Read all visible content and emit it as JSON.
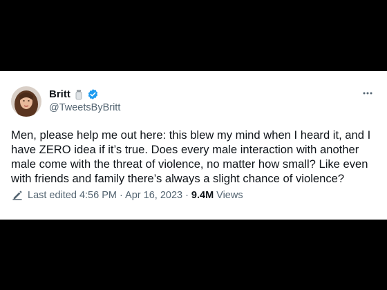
{
  "tweet": {
    "author_name": "Britt",
    "handle": "@TweetsByBritt",
    "text": "Men, please help me out here: this blew my mind when I heard it, and I have ZERO idea if it’s true. Does every male interaction with another male come with the threat of violence, no matter how small? Like even with friends and family there’s always a slight chance of violence?",
    "last_edited_label": "Last edited",
    "timestamp": "4:56 PM · Apr 16, 2023",
    "separator": "·",
    "views_count": "9.4M",
    "views_label": "Views"
  },
  "icons": {
    "emoji": "salt-shaker-icon",
    "badge": "verified-badge-icon",
    "more": "more-options-icon",
    "edit": "pencil-edit-icon"
  },
  "colors": {
    "background": "#000000",
    "card": "#ffffff",
    "text_primary": "#0f1419",
    "text_secondary": "#536471",
    "verified_blue": "#1d9bf0"
  }
}
